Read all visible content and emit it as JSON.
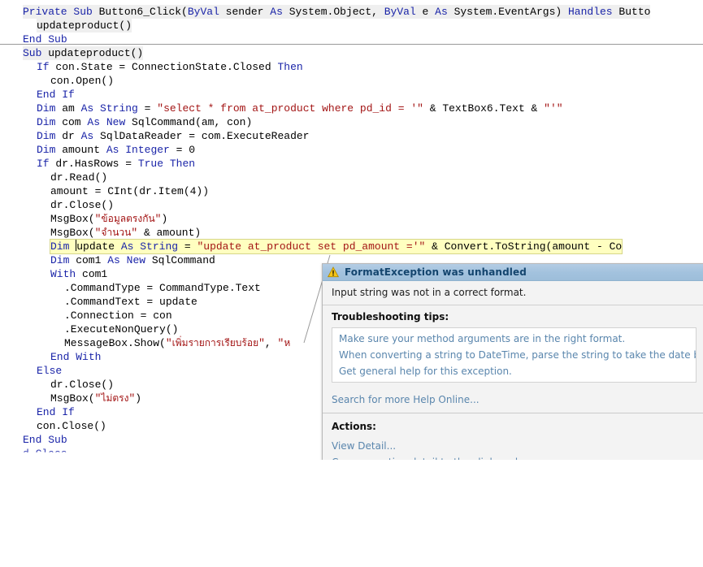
{
  "editor": {
    "language": "vb",
    "separator_after_line_index": 3,
    "highlight_color": "#ffffc0",
    "keyword_color": "#1a24a8",
    "string_color": "#a31515",
    "lines": [
      {
        "indent": 0,
        "band": true,
        "segments": [
          {
            "t": "Private",
            "c": "kw"
          },
          {
            "t": " ",
            "c": "plain"
          },
          {
            "t": "Sub",
            "c": "kw"
          },
          {
            "t": " Button6_Click(",
            "c": "plain"
          },
          {
            "t": "ByVal",
            "c": "kw"
          },
          {
            "t": " sender ",
            "c": "plain"
          },
          {
            "t": "As",
            "c": "kw"
          },
          {
            "t": " System.Object, ",
            "c": "plain"
          },
          {
            "t": "ByVal",
            "c": "kw"
          },
          {
            "t": " e ",
            "c": "plain"
          },
          {
            "t": "As",
            "c": "kw"
          },
          {
            "t": " System.EventArgs) ",
            "c": "plain"
          },
          {
            "t": "Handles",
            "c": "kw"
          },
          {
            "t": " Butto",
            "c": "plain"
          }
        ]
      },
      {
        "indent": 1,
        "band": true,
        "segments": [
          {
            "t": "updateproduct()",
            "c": "plain"
          }
        ]
      },
      {
        "indent": 0,
        "band": false,
        "segments": [
          {
            "t": "End",
            "c": "kw"
          },
          {
            "t": " ",
            "c": "plain"
          },
          {
            "t": "Sub",
            "c": "kw"
          }
        ]
      },
      {
        "indent": 0,
        "band": true,
        "segments": [
          {
            "t": "Sub",
            "c": "kw"
          },
          {
            "t": " updateproduct()",
            "c": "plain"
          }
        ]
      },
      {
        "indent": 1,
        "band": false,
        "segments": [
          {
            "t": "If",
            "c": "kw"
          },
          {
            "t": " con.State = ConnectionState.Closed ",
            "c": "plain"
          },
          {
            "t": "Then",
            "c": "kw"
          }
        ]
      },
      {
        "indent": 2,
        "band": false,
        "segments": [
          {
            "t": "con.Open()",
            "c": "plain"
          }
        ]
      },
      {
        "indent": 1,
        "band": false,
        "segments": [
          {
            "t": "End",
            "c": "kw"
          },
          {
            "t": " ",
            "c": "plain"
          },
          {
            "t": "If",
            "c": "kw"
          }
        ]
      },
      {
        "indent": 1,
        "band": false,
        "segments": [
          {
            "t": "Dim",
            "c": "kw"
          },
          {
            "t": " am ",
            "c": "plain"
          },
          {
            "t": "As",
            "c": "kw"
          },
          {
            "t": " ",
            "c": "plain"
          },
          {
            "t": "String",
            "c": "kw"
          },
          {
            "t": " = ",
            "c": "plain"
          },
          {
            "t": "\"select * from at_product where pd_id = '\"",
            "c": "str"
          },
          {
            "t": " & TextBox6.Text & ",
            "c": "plain"
          },
          {
            "t": "\"'\"",
            "c": "str"
          }
        ]
      },
      {
        "indent": 1,
        "band": false,
        "segments": [
          {
            "t": "Dim",
            "c": "kw"
          },
          {
            "t": " com ",
            "c": "plain"
          },
          {
            "t": "As",
            "c": "kw"
          },
          {
            "t": " ",
            "c": "plain"
          },
          {
            "t": "New",
            "c": "kw"
          },
          {
            "t": " SqlCommand(am, con)",
            "c": "plain"
          }
        ]
      },
      {
        "indent": 1,
        "band": false,
        "segments": [
          {
            "t": "Dim",
            "c": "kw"
          },
          {
            "t": " dr ",
            "c": "plain"
          },
          {
            "t": "As",
            "c": "kw"
          },
          {
            "t": " SqlDataReader = com.ExecuteReader",
            "c": "plain"
          }
        ]
      },
      {
        "indent": 1,
        "band": false,
        "segments": [
          {
            "t": "Dim",
            "c": "kw"
          },
          {
            "t": " amount ",
            "c": "plain"
          },
          {
            "t": "As",
            "c": "kw"
          },
          {
            "t": " ",
            "c": "plain"
          },
          {
            "t": "Integer",
            "c": "kw"
          },
          {
            "t": " = 0",
            "c": "plain"
          }
        ]
      },
      {
        "indent": 1,
        "band": false,
        "segments": [
          {
            "t": "If",
            "c": "kw"
          },
          {
            "t": " dr.HasRows = ",
            "c": "plain"
          },
          {
            "t": "True",
            "c": "kw"
          },
          {
            "t": " ",
            "c": "plain"
          },
          {
            "t": "Then",
            "c": "kw"
          }
        ]
      },
      {
        "indent": 2,
        "band": false,
        "segments": [
          {
            "t": "dr.Read()",
            "c": "plain"
          }
        ]
      },
      {
        "indent": 2,
        "band": false,
        "segments": [
          {
            "t": "amount = CInt(dr.Item(4))",
            "c": "plain"
          }
        ]
      },
      {
        "indent": 2,
        "band": false,
        "segments": [
          {
            "t": "dr.Close()",
            "c": "plain"
          }
        ]
      },
      {
        "indent": 2,
        "band": false,
        "segments": [
          {
            "t": "MsgBox(",
            "c": "plain"
          },
          {
            "t": "\"",
            "c": "str"
          },
          {
            "t": "ข้อมูลตรงกัน",
            "c": "thai"
          },
          {
            "t": "\"",
            "c": "str"
          },
          {
            "t": ")",
            "c": "plain"
          }
        ]
      },
      {
        "indent": 2,
        "band": false,
        "segments": [
          {
            "t": "MsgBox(",
            "c": "plain"
          },
          {
            "t": "\"",
            "c": "str"
          },
          {
            "t": "จำนวน",
            "c": "thai"
          },
          {
            "t": "\"",
            "c": "str"
          },
          {
            "t": " & amount)",
            "c": "plain"
          }
        ]
      },
      {
        "indent": 2,
        "band": false,
        "highlight": true,
        "caret_after_segment": 0,
        "segments": [
          {
            "t": "Dim ",
            "c": "kw"
          },
          {
            "t": "update ",
            "c": "plain"
          },
          {
            "t": "As",
            "c": "kw"
          },
          {
            "t": " ",
            "c": "plain"
          },
          {
            "t": "String",
            "c": "kw"
          },
          {
            "t": " = ",
            "c": "plain"
          },
          {
            "t": "\"update at_product set pd_amount ='\"",
            "c": "str"
          },
          {
            "t": " & Convert.ToString(amount - Co",
            "c": "plain"
          }
        ]
      },
      {
        "indent": 2,
        "band": false,
        "segments": [
          {
            "t": "Dim",
            "c": "kw"
          },
          {
            "t": " com1 ",
            "c": "plain"
          },
          {
            "t": "As",
            "c": "kw"
          },
          {
            "t": " ",
            "c": "plain"
          },
          {
            "t": "New",
            "c": "kw"
          },
          {
            "t": " SqlCommand",
            "c": "plain"
          }
        ]
      },
      {
        "indent": 2,
        "band": false,
        "segments": [
          {
            "t": "With",
            "c": "kw"
          },
          {
            "t": " com1",
            "c": "plain"
          }
        ]
      },
      {
        "indent": 3,
        "band": false,
        "segments": [
          {
            "t": ".CommandType = CommandType.Text",
            "c": "plain"
          }
        ]
      },
      {
        "indent": 3,
        "band": false,
        "segments": [
          {
            "t": ".CommandText = update",
            "c": "plain"
          }
        ]
      },
      {
        "indent": 3,
        "band": false,
        "segments": [
          {
            "t": ".Connection = con",
            "c": "plain"
          }
        ]
      },
      {
        "indent": 3,
        "band": false,
        "segments": [
          {
            "t": ".ExecuteNonQuery()",
            "c": "plain"
          }
        ]
      },
      {
        "indent": 3,
        "band": false,
        "segments": [
          {
            "t": "MessageBox.Show(",
            "c": "plain"
          },
          {
            "t": "\"",
            "c": "str"
          },
          {
            "t": "เพิ่มรายการเรียบร้อย",
            "c": "thai"
          },
          {
            "t": "\"",
            "c": "str"
          },
          {
            "t": ", ",
            "c": "plain"
          },
          {
            "t": "\"",
            "c": "str"
          },
          {
            "t": "ห",
            "c": "thai"
          }
        ]
      },
      {
        "indent": 2,
        "band": false,
        "segments": [
          {
            "t": "End",
            "c": "kw"
          },
          {
            "t": " ",
            "c": "plain"
          },
          {
            "t": "With",
            "c": "kw"
          }
        ]
      },
      {
        "indent": 1,
        "band": false,
        "segments": [
          {
            "t": "Else",
            "c": "kw"
          }
        ]
      },
      {
        "indent": 2,
        "band": false,
        "segments": [
          {
            "t": "dr.Close()",
            "c": "plain"
          }
        ]
      },
      {
        "indent": 2,
        "band": false,
        "segments": [
          {
            "t": "MsgBox(",
            "c": "plain"
          },
          {
            "t": "\"",
            "c": "str"
          },
          {
            "t": "ไม่ตรง",
            "c": "thai"
          },
          {
            "t": "\"",
            "c": "str"
          },
          {
            "t": ")",
            "c": "plain"
          }
        ]
      },
      {
        "indent": 1,
        "band": false,
        "segments": [
          {
            "t": "End",
            "c": "kw"
          },
          {
            "t": " ",
            "c": "plain"
          },
          {
            "t": "If",
            "c": "kw"
          }
        ]
      },
      {
        "indent": 1,
        "band": false,
        "segments": [
          {
            "t": "con.Close()",
            "c": "plain"
          }
        ]
      },
      {
        "indent": 0,
        "band": false,
        "segments": [
          {
            "t": "End",
            "c": "kw"
          },
          {
            "t": " ",
            "c": "plain"
          },
          {
            "t": "Sub",
            "c": "kw"
          }
        ]
      },
      {
        "indent": 0,
        "band": false,
        "clipped": true,
        "segments": [
          {
            "t": "d Class",
            "c": "kw"
          }
        ]
      }
    ]
  },
  "exception_popup": {
    "icon": "warning-triangle-icon",
    "title": "FormatException was unhandled",
    "message": "Input string was not in a correct format.",
    "troubleshooting_label": "Troubleshooting tips:",
    "tips": [
      "Make sure your method arguments are in the right format.",
      "When converting a string to DateTime, parse the string to take the date before pu",
      "Get general help for this exception."
    ],
    "search_link": "Search for more Help Online...",
    "actions_label": "Actions:",
    "actions": [
      "View Detail...",
      "Copy exception detail to the clipboard"
    ],
    "colors": {
      "title_bar": "#a3c2de",
      "title_text": "#14456e",
      "link": "#5a86ad",
      "body": "#f3f3f3"
    }
  }
}
